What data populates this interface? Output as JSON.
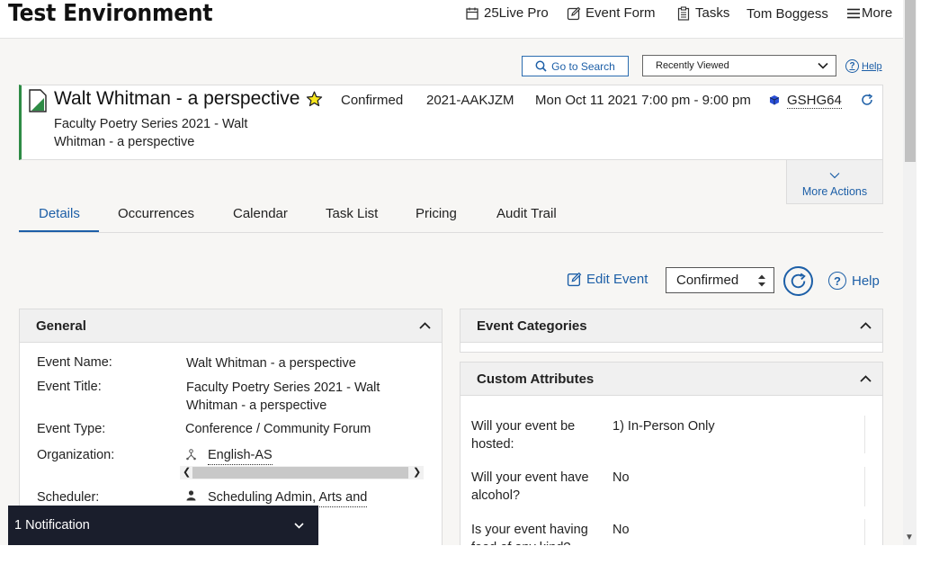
{
  "app": {
    "title": "Test Environment"
  },
  "nav": {
    "items": [
      {
        "label": "25Live Pro",
        "icon": "calendar-icon"
      },
      {
        "label": "Event Form",
        "icon": "edit-icon"
      },
      {
        "label": "Tasks",
        "icon": "clipboard-icon"
      },
      {
        "label": "Tom Boggess"
      },
      {
        "label": "More",
        "icon": "hamburger-icon"
      }
    ]
  },
  "search": {
    "go_to_search": "Go to Search",
    "recently_viewed": "Recently Viewed",
    "help": "Help"
  },
  "event": {
    "name": "Walt Whitman - a perspective",
    "title_line": "Faculty Poetry Series 2021 - Walt Whitman - a perspective",
    "state": "Confirmed",
    "reference": "2021-AAKJZM",
    "datetime": "Mon Oct 11 2021 7:00 pm - 9:00 pm",
    "location_code": "GSHG64",
    "more_actions": "More Actions"
  },
  "tabs": [
    "Details",
    "Occurrences",
    "Calendar",
    "Task List",
    "Pricing",
    "Audit Trail"
  ],
  "actions": {
    "edit_event": "Edit Event",
    "state_value": "Confirmed",
    "help": "Help"
  },
  "general": {
    "header": "General",
    "rows": [
      {
        "label": "Event Name:",
        "value": "Walt Whitman - a perspective"
      },
      {
        "label": "Event Title:",
        "value": "Faculty Poetry Series 2021 - Walt Whitman - a perspective"
      },
      {
        "label": "Event Type:",
        "value": "Conference / Community Forum"
      },
      {
        "label": "Organization:",
        "value": "English-AS"
      },
      {
        "label": "Scheduler:",
        "value": "Scheduling Admin, Arts and"
      }
    ]
  },
  "categories": {
    "header": "Event Categories"
  },
  "custom_attributes": {
    "header": "Custom Attributes",
    "rows": [
      {
        "label": "Will your event be hosted:",
        "value": "1) In-Person Only"
      },
      {
        "label": "Will your event have alcohol?",
        "value": "No"
      },
      {
        "label": "Is your event having food of any kind?",
        "value": "No"
      }
    ]
  },
  "notification": {
    "label": "1 Notification"
  },
  "colors": {
    "accent": "#1d5fa7",
    "confirmed_bar": "#2e8b45",
    "notification_bg": "#1a1e2c"
  }
}
